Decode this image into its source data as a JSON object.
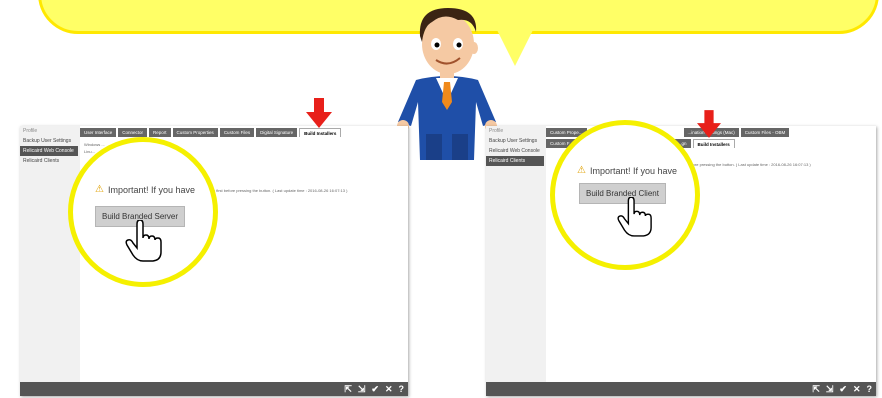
{
  "left_window": {
    "sidebar": {
      "logo": "Profile",
      "items": [
        {
          "label": "Backup User Settings"
        },
        {
          "label": "Relicaird Web Console"
        },
        {
          "label": "Relicaird Clients"
        }
      ]
    },
    "tabs": [
      {
        "label": "User Interface"
      },
      {
        "label": "Connector"
      },
      {
        "label": "Report"
      },
      {
        "label": "Custom Properties"
      },
      {
        "label": "Custom Files"
      },
      {
        "label": "Digital Signature"
      },
      {
        "label": "Build Installers"
      }
    ],
    "checkbox_1": "Windows ...",
    "checkbox_2": "Linu...",
    "instruction_tail": "...are first before pressing the button. ( Last update time : 2016-08-26 16:07:13 )",
    "warning": "Important! If you have",
    "build_button": "Build Branded Server"
  },
  "right_window": {
    "sidebar": {
      "logo": "Profile",
      "items": [
        {
          "label": "Backup User Settings"
        },
        {
          "label": "Relicaird Web Console"
        },
        {
          "label": "Relicaird Clients"
        }
      ]
    },
    "tabs_row1": [
      {
        "label": "Custom Prope..."
      },
      {
        "label": "...ination Settings (Mac)"
      },
      {
        "label": "Custom Files - OBM"
      }
    ],
    "tabs_row2": [
      {
        "label": "Custom F..."
      },
      {
        "label": "...gn"
      },
      {
        "label": "Build Installers"
      }
    ],
    "instruction_tail": "...efore pressing the button. ( Last update time : 2016-08-26 16:07:13 )",
    "warning": "Important! If you have",
    "build_button": "Build Branded Client"
  },
  "bottom_icons": [
    "export-icon",
    "import-icon",
    "check-icon",
    "close-icon",
    "help-icon"
  ],
  "bottom_icon_glyphs": [
    "⇱",
    "⇲",
    "✔",
    "✕",
    "?"
  ],
  "colors": {
    "bubble": "#ffff66",
    "circle_ring": "#f5f000",
    "arrow": "#e8201a"
  }
}
